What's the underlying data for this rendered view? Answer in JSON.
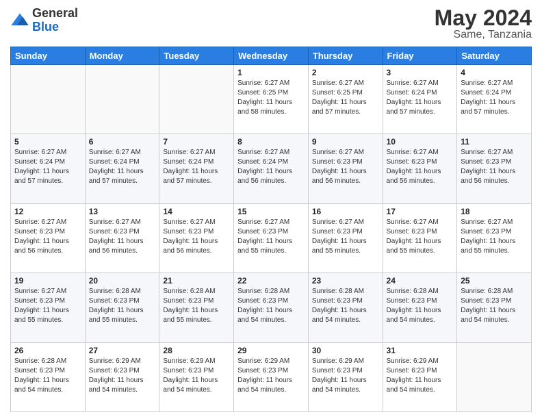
{
  "header": {
    "logo_general": "General",
    "logo_blue": "Blue",
    "month_title": "May 2024",
    "location": "Same, Tanzania"
  },
  "days_of_week": [
    "Sunday",
    "Monday",
    "Tuesday",
    "Wednesday",
    "Thursday",
    "Friday",
    "Saturday"
  ],
  "weeks": [
    [
      {
        "day": "",
        "info": ""
      },
      {
        "day": "",
        "info": ""
      },
      {
        "day": "",
        "info": ""
      },
      {
        "day": "1",
        "info": "Sunrise: 6:27 AM\nSunset: 6:25 PM\nDaylight: 11 hours\nand 58 minutes."
      },
      {
        "day": "2",
        "info": "Sunrise: 6:27 AM\nSunset: 6:25 PM\nDaylight: 11 hours\nand 57 minutes."
      },
      {
        "day": "3",
        "info": "Sunrise: 6:27 AM\nSunset: 6:24 PM\nDaylight: 11 hours\nand 57 minutes."
      },
      {
        "day": "4",
        "info": "Sunrise: 6:27 AM\nSunset: 6:24 PM\nDaylight: 11 hours\nand 57 minutes."
      }
    ],
    [
      {
        "day": "5",
        "info": "Sunrise: 6:27 AM\nSunset: 6:24 PM\nDaylight: 11 hours\nand 57 minutes."
      },
      {
        "day": "6",
        "info": "Sunrise: 6:27 AM\nSunset: 6:24 PM\nDaylight: 11 hours\nand 57 minutes."
      },
      {
        "day": "7",
        "info": "Sunrise: 6:27 AM\nSunset: 6:24 PM\nDaylight: 11 hours\nand 57 minutes."
      },
      {
        "day": "8",
        "info": "Sunrise: 6:27 AM\nSunset: 6:24 PM\nDaylight: 11 hours\nand 56 minutes."
      },
      {
        "day": "9",
        "info": "Sunrise: 6:27 AM\nSunset: 6:23 PM\nDaylight: 11 hours\nand 56 minutes."
      },
      {
        "day": "10",
        "info": "Sunrise: 6:27 AM\nSunset: 6:23 PM\nDaylight: 11 hours\nand 56 minutes."
      },
      {
        "day": "11",
        "info": "Sunrise: 6:27 AM\nSunset: 6:23 PM\nDaylight: 11 hours\nand 56 minutes."
      }
    ],
    [
      {
        "day": "12",
        "info": "Sunrise: 6:27 AM\nSunset: 6:23 PM\nDaylight: 11 hours\nand 56 minutes."
      },
      {
        "day": "13",
        "info": "Sunrise: 6:27 AM\nSunset: 6:23 PM\nDaylight: 11 hours\nand 56 minutes."
      },
      {
        "day": "14",
        "info": "Sunrise: 6:27 AM\nSunset: 6:23 PM\nDaylight: 11 hours\nand 56 minutes."
      },
      {
        "day": "15",
        "info": "Sunrise: 6:27 AM\nSunset: 6:23 PM\nDaylight: 11 hours\nand 55 minutes."
      },
      {
        "day": "16",
        "info": "Sunrise: 6:27 AM\nSunset: 6:23 PM\nDaylight: 11 hours\nand 55 minutes."
      },
      {
        "day": "17",
        "info": "Sunrise: 6:27 AM\nSunset: 6:23 PM\nDaylight: 11 hours\nand 55 minutes."
      },
      {
        "day": "18",
        "info": "Sunrise: 6:27 AM\nSunset: 6:23 PM\nDaylight: 11 hours\nand 55 minutes."
      }
    ],
    [
      {
        "day": "19",
        "info": "Sunrise: 6:27 AM\nSunset: 6:23 PM\nDaylight: 11 hours\nand 55 minutes."
      },
      {
        "day": "20",
        "info": "Sunrise: 6:28 AM\nSunset: 6:23 PM\nDaylight: 11 hours\nand 55 minutes."
      },
      {
        "day": "21",
        "info": "Sunrise: 6:28 AM\nSunset: 6:23 PM\nDaylight: 11 hours\nand 55 minutes."
      },
      {
        "day": "22",
        "info": "Sunrise: 6:28 AM\nSunset: 6:23 PM\nDaylight: 11 hours\nand 54 minutes."
      },
      {
        "day": "23",
        "info": "Sunrise: 6:28 AM\nSunset: 6:23 PM\nDaylight: 11 hours\nand 54 minutes."
      },
      {
        "day": "24",
        "info": "Sunrise: 6:28 AM\nSunset: 6:23 PM\nDaylight: 11 hours\nand 54 minutes."
      },
      {
        "day": "25",
        "info": "Sunrise: 6:28 AM\nSunset: 6:23 PM\nDaylight: 11 hours\nand 54 minutes."
      }
    ],
    [
      {
        "day": "26",
        "info": "Sunrise: 6:28 AM\nSunset: 6:23 PM\nDaylight: 11 hours\nand 54 minutes."
      },
      {
        "day": "27",
        "info": "Sunrise: 6:29 AM\nSunset: 6:23 PM\nDaylight: 11 hours\nand 54 minutes."
      },
      {
        "day": "28",
        "info": "Sunrise: 6:29 AM\nSunset: 6:23 PM\nDaylight: 11 hours\nand 54 minutes."
      },
      {
        "day": "29",
        "info": "Sunrise: 6:29 AM\nSunset: 6:23 PM\nDaylight: 11 hours\nand 54 minutes."
      },
      {
        "day": "30",
        "info": "Sunrise: 6:29 AM\nSunset: 6:23 PM\nDaylight: 11 hours\nand 54 minutes."
      },
      {
        "day": "31",
        "info": "Sunrise: 6:29 AM\nSunset: 6:23 PM\nDaylight: 11 hours\nand 54 minutes."
      },
      {
        "day": "",
        "info": ""
      }
    ]
  ]
}
